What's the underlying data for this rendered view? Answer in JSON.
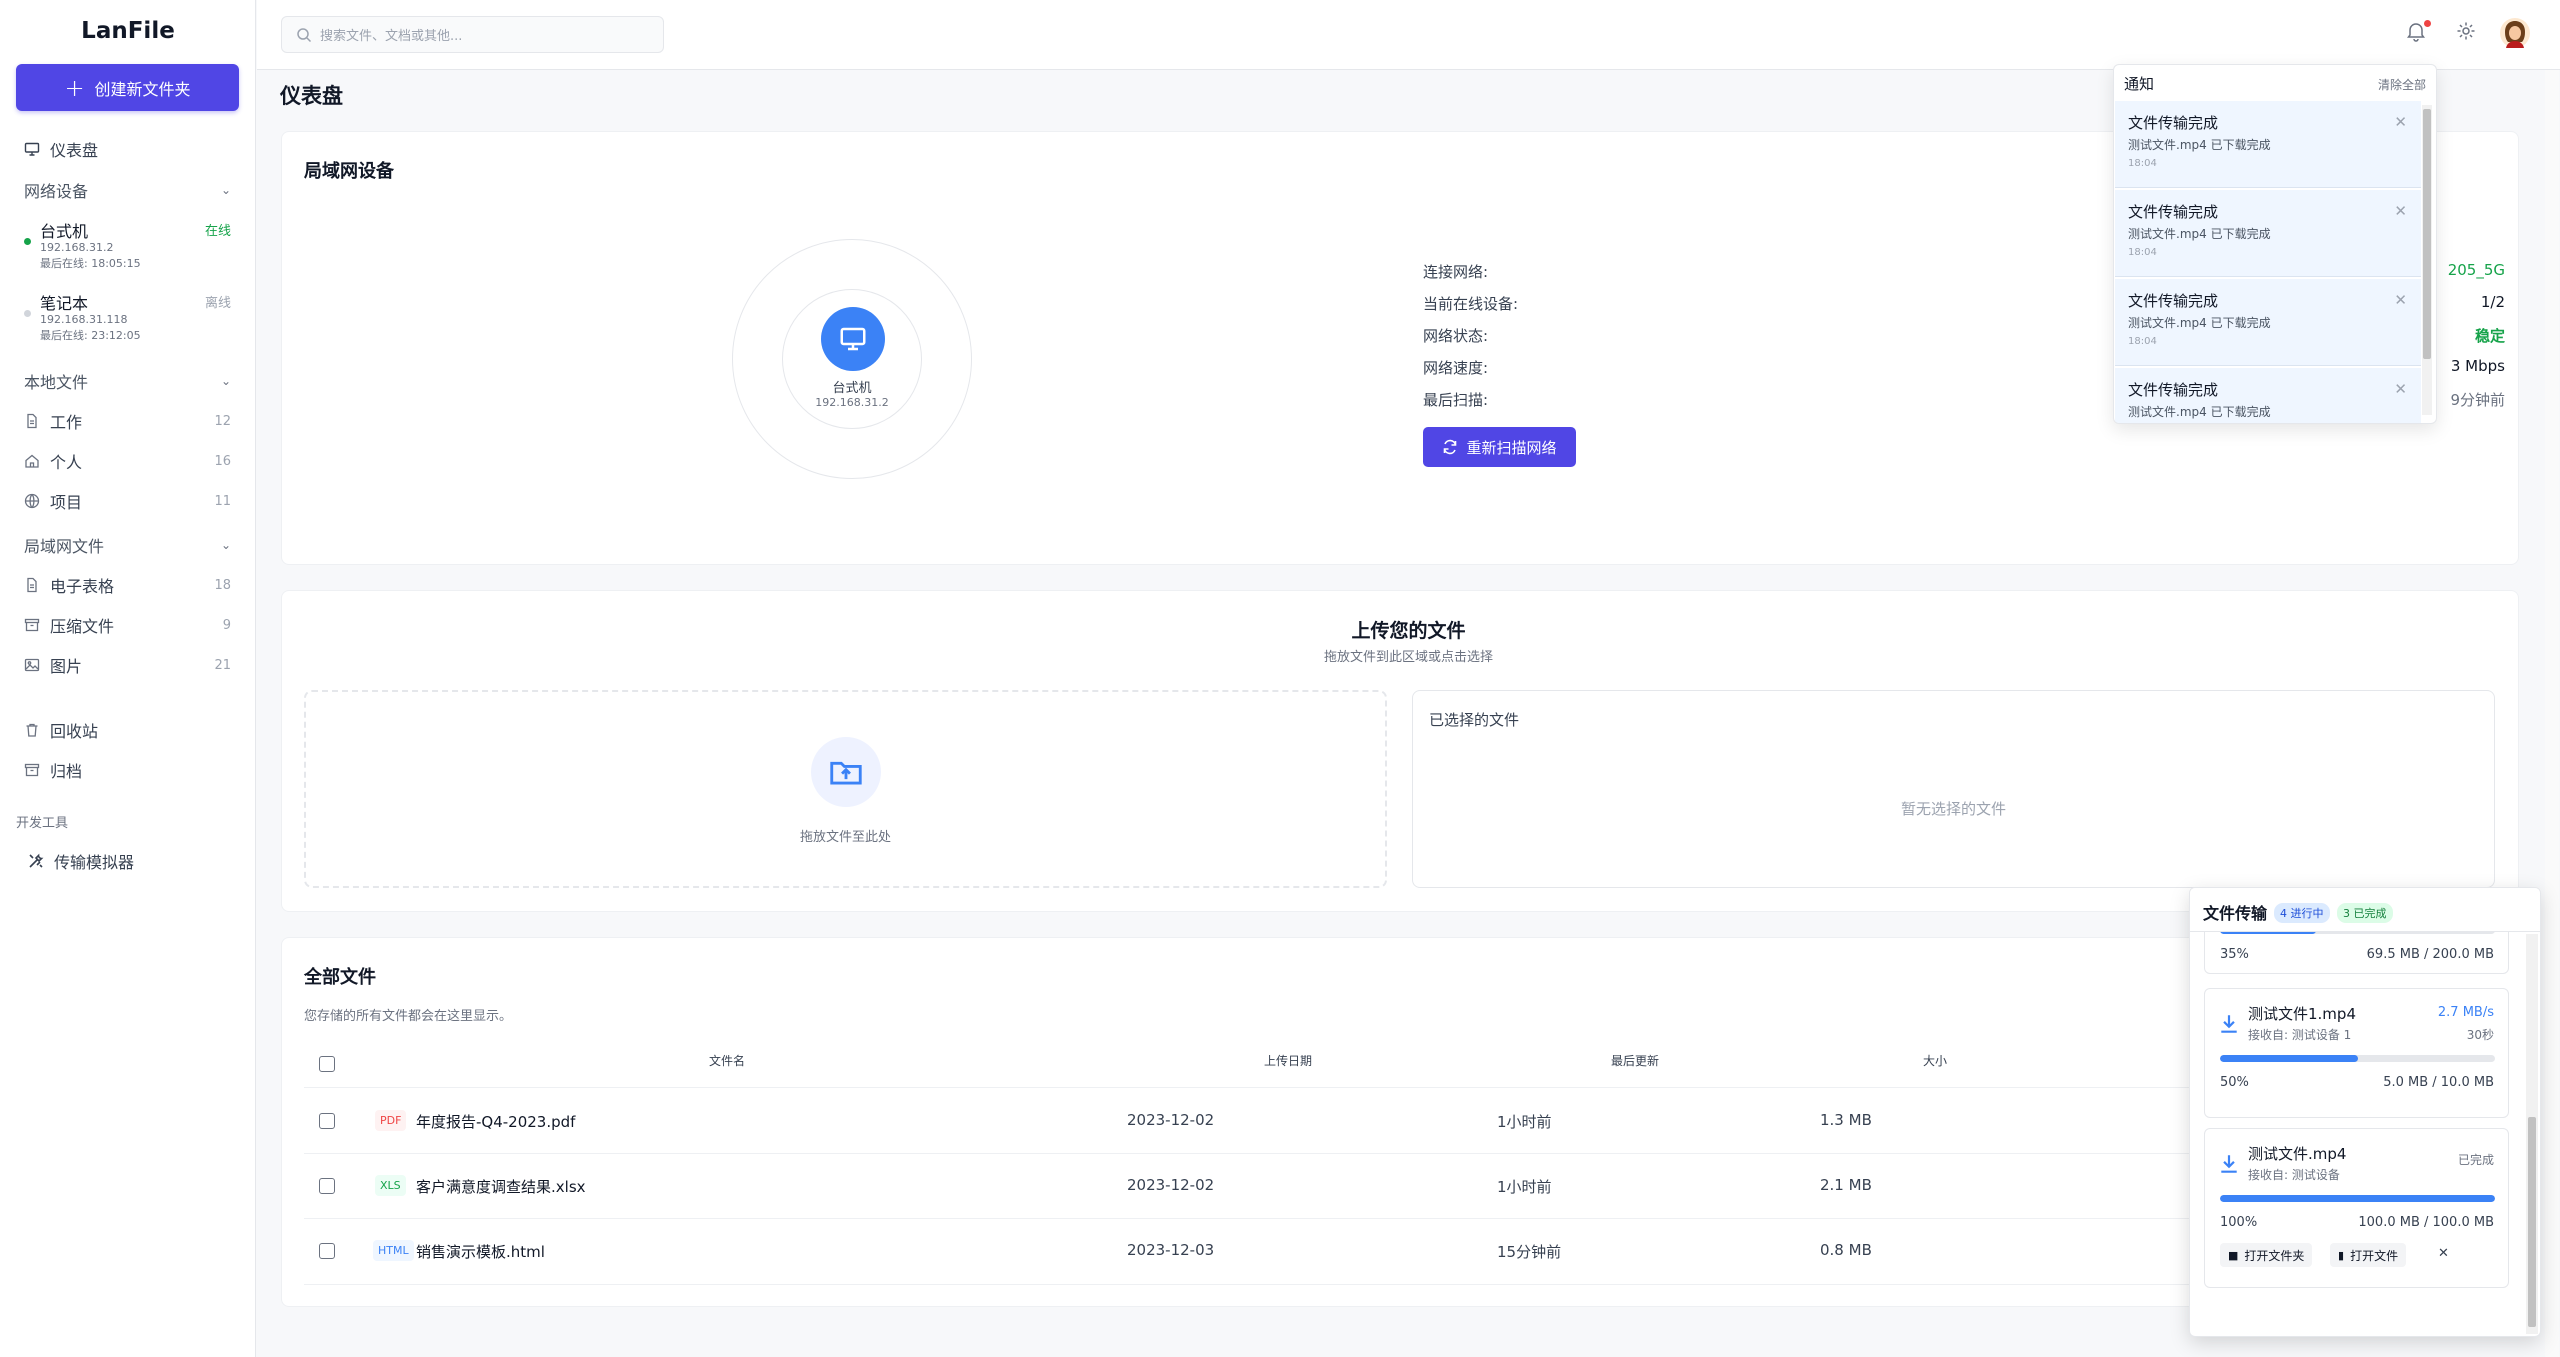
{
  "app": {
    "title": "LanFile"
  },
  "sidebar": {
    "create_label": "创建新文件夹",
    "dashboard_label": "仪表盘",
    "network_section": "网络设备",
    "devices": [
      {
        "name": "台式机",
        "ip": "192.168.31.2",
        "last_seen": "最后在线: 18:05:15",
        "status": "在线",
        "status_color": "#16a34a"
      },
      {
        "name": "笔记本",
        "ip": "192.168.31.118",
        "last_seen": "最后在线: 23:12:05",
        "status": "离线",
        "status_color": "#9ca3af"
      }
    ],
    "local_section": "本地文件",
    "local_items": [
      {
        "label": "工作",
        "count": "12",
        "icon": "file-icon"
      },
      {
        "label": "个人",
        "count": "16",
        "icon": "home-icon"
      },
      {
        "label": "项目",
        "count": "11",
        "icon": "globe-icon"
      }
    ],
    "lan_section": "局域网文件",
    "lan_items": [
      {
        "label": "电子表格",
        "count": "18",
        "icon": "file-icon"
      },
      {
        "label": "压缩文件",
        "count": "9",
        "icon": "archive-icon"
      },
      {
        "label": "图片",
        "count": "21",
        "icon": "image-icon"
      }
    ],
    "trash_label": "回收站",
    "archive_label": "归档",
    "dev_tools_section": "开发工具",
    "simulator_label": "传输模拟器"
  },
  "topbar": {
    "search_placeholder": "搜索文件、文档或其他..."
  },
  "main": {
    "page_title": "仪表盘",
    "lan_card": {
      "title": "局域网设备",
      "center_device_name": "台式机",
      "center_device_ip": "192.168.31.2",
      "labels": [
        "连接网络:",
        "当前在线设备:",
        "网络状态:",
        "网络速度:",
        "最后扫描:"
      ],
      "values": [
        "205_5G",
        "1/2",
        "稳定",
        "3 Mbps",
        "9分钟前"
      ],
      "rescan_label": "重新扫描网络"
    },
    "upload": {
      "title": "上传您的文件",
      "subtitle": "拖放文件到此区域或点击选择",
      "drop_text": "拖放文件至此处",
      "selected_title": "已选择的文件",
      "selected_empty": "暂无选择的文件"
    },
    "files": {
      "title": "全部文件",
      "subtitle": "您存储的所有文件都会在这里显示。",
      "headers": [
        "文件名",
        "上传日期",
        "最后更新",
        "大小"
      ],
      "rows": [
        {
          "type": "PDF",
          "name": "年度报告-Q4-2023.pdf",
          "uploaded": "2023-12-02",
          "updated": "1小时前",
          "size": "1.3 MB"
        },
        {
          "type": "XLS",
          "name": "客户满意度调查结果.xlsx",
          "uploaded": "2023-12-02",
          "updated": "1小时前",
          "size": "2.1 MB"
        },
        {
          "type": "HTML",
          "name": "销售演示模板.html",
          "uploaded": "2023-12-03",
          "updated": "15分钟前",
          "size": "0.8 MB"
        }
      ]
    }
  },
  "notifications": {
    "title": "通知",
    "clear_label": "清除全部",
    "items": [
      {
        "title": "文件传输完成",
        "desc": "测试文件.mp4 已下载完成",
        "time": "18:04"
      },
      {
        "title": "文件传输完成",
        "desc": "测试文件.mp4 已下载完成",
        "time": "18:04"
      },
      {
        "title": "文件传输完成",
        "desc": "测试文件.mp4 已下载完成",
        "time": "18:04"
      },
      {
        "title": "文件传输完成",
        "desc": "测试文件.mp4 已下载完成",
        "time": ""
      }
    ]
  },
  "transfers": {
    "title": "文件传输",
    "in_progress_badge": "4 进行中",
    "done_badge": "3 已完成",
    "items": [
      {
        "name": "",
        "receiver": "",
        "speed": "",
        "eta": "",
        "percent_label": "35%",
        "progress": 0.35,
        "size_text": "69.5 MB / 200.0 MB"
      },
      {
        "name": "测试文件1.mp4",
        "receiver": "接收自: 测试设备 1",
        "speed": "2.7 MB/s",
        "eta": "30秒",
        "percent_label": "50%",
        "progress": 0.5,
        "size_text": "5.0 MB / 10.0 MB"
      },
      {
        "name": "测试文件.mp4",
        "receiver": "接收自: 测试设备",
        "speed": "已完成",
        "eta": "",
        "percent_label": "100%",
        "progress": 1.0,
        "size_text": "100.0 MB / 100.0 MB"
      }
    ],
    "open_folder_label": "打开文件夹",
    "open_file_label": "打开文件"
  },
  "colors": {
    "accent": "#5046e5",
    "device_blue": "#3b82f6",
    "online_green": "#16a34a"
  }
}
